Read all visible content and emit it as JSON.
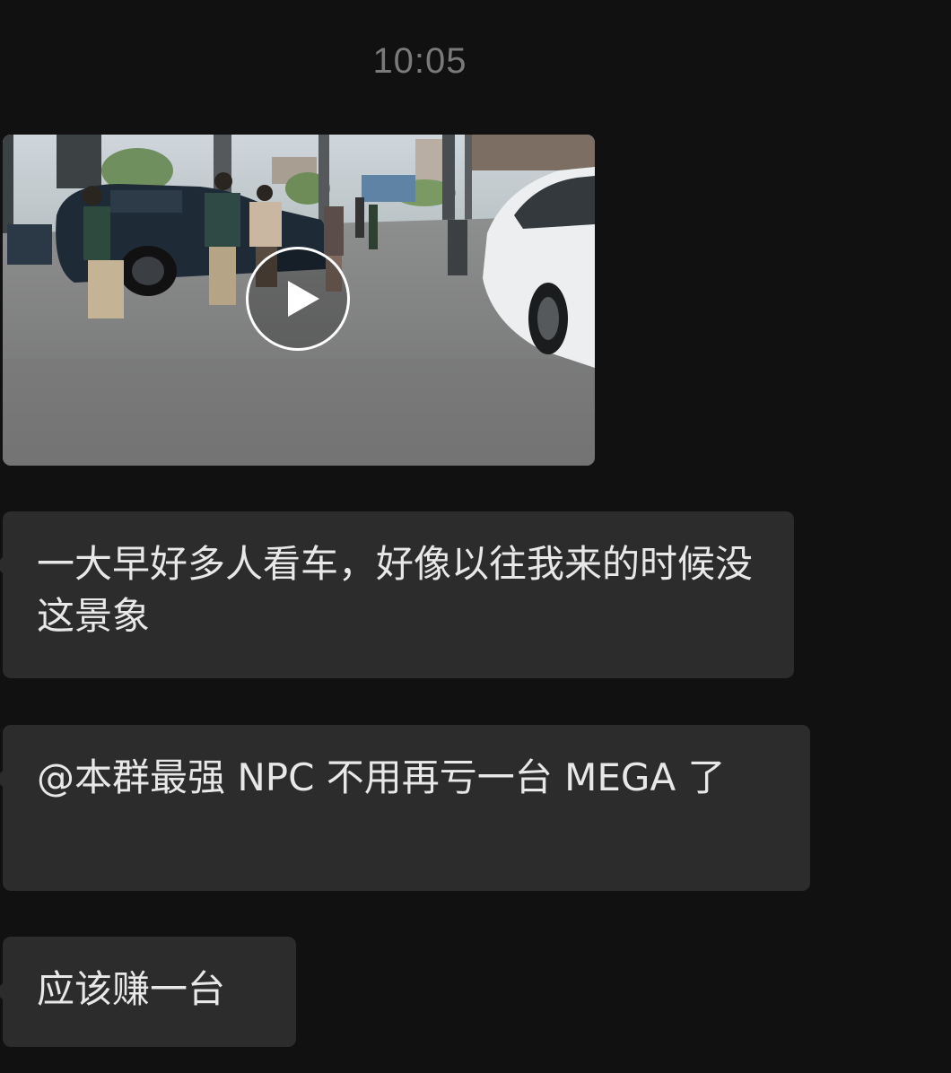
{
  "chat": {
    "timestamp": "10:05",
    "messages": [
      {
        "type": "video",
        "thumbnail": "car-showroom-video-thumbnail",
        "icon": "play-icon"
      },
      {
        "type": "text",
        "text": "一大早好多人看车，好像以往我来的时候没这景象"
      },
      {
        "type": "text",
        "text": "@本群最强 NPC 不用再亏一台 MEGA 了"
      },
      {
        "type": "text",
        "text": "应该赚一台"
      }
    ]
  },
  "colors": {
    "background": "#111111",
    "bubble": "#2c2c2c",
    "text": "#e8e8e8",
    "timestamp": "#7a7a7a"
  }
}
